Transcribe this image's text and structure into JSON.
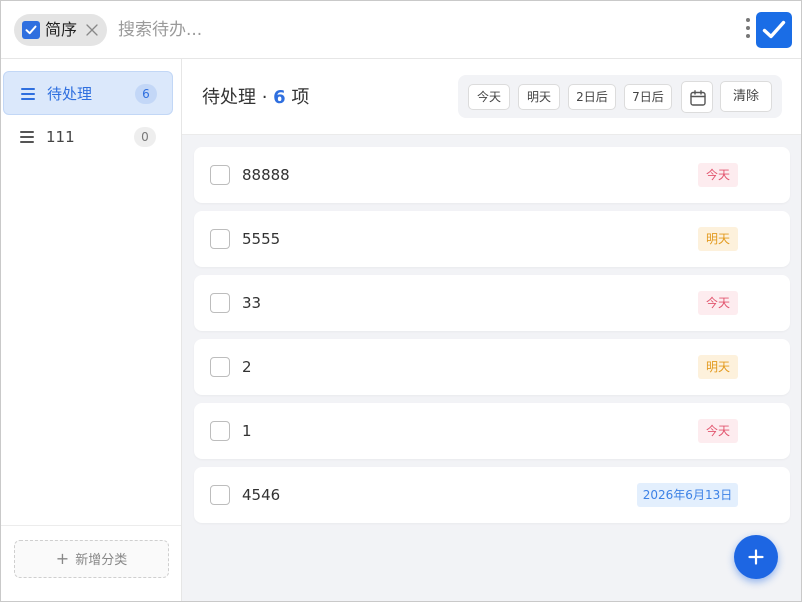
{
  "topbar": {
    "mode_chip_label": "简序",
    "search_placeholder": "搜索待办..."
  },
  "sidebar": {
    "categories": [
      {
        "label": "待处理",
        "count": "6",
        "active": true
      },
      {
        "label": "111",
        "count": "0",
        "active": false
      }
    ],
    "add_category_label": "新增分类"
  },
  "main": {
    "title_prefix": "待处理 · ",
    "title_count": "6",
    "title_suffix": " 项",
    "filters": {
      "today": "今天",
      "tomorrow": "明天",
      "two_days": "2日后",
      "seven_days": "7日后",
      "clear": "清除"
    },
    "todos": [
      {
        "text": "88888",
        "due": "今天",
        "due_kind": "today"
      },
      {
        "text": "5555",
        "due": "明天",
        "due_kind": "tomorrow"
      },
      {
        "text": "33",
        "due": "今天",
        "due_kind": "today"
      },
      {
        "text": "2",
        "due": "明天",
        "due_kind": "tomorrow"
      },
      {
        "text": "1",
        "due": "今天",
        "due_kind": "today"
      },
      {
        "text": "4546",
        "due": "2026年6月13日",
        "due_kind": "date"
      }
    ]
  },
  "colors": {
    "accent": "#2f6fdf",
    "today_tag": "#e2566f",
    "tomorrow_tag": "#e39a1f",
    "date_tag": "#3d82e6"
  },
  "icons": {
    "chip_check": "checkbox-checked-icon",
    "chip_close": "close-icon",
    "more": "more-vertical-icon",
    "app": "app-check-icon",
    "category": "menu-lines-icon",
    "calendar": "calendar-icon",
    "add": "plus-icon"
  }
}
